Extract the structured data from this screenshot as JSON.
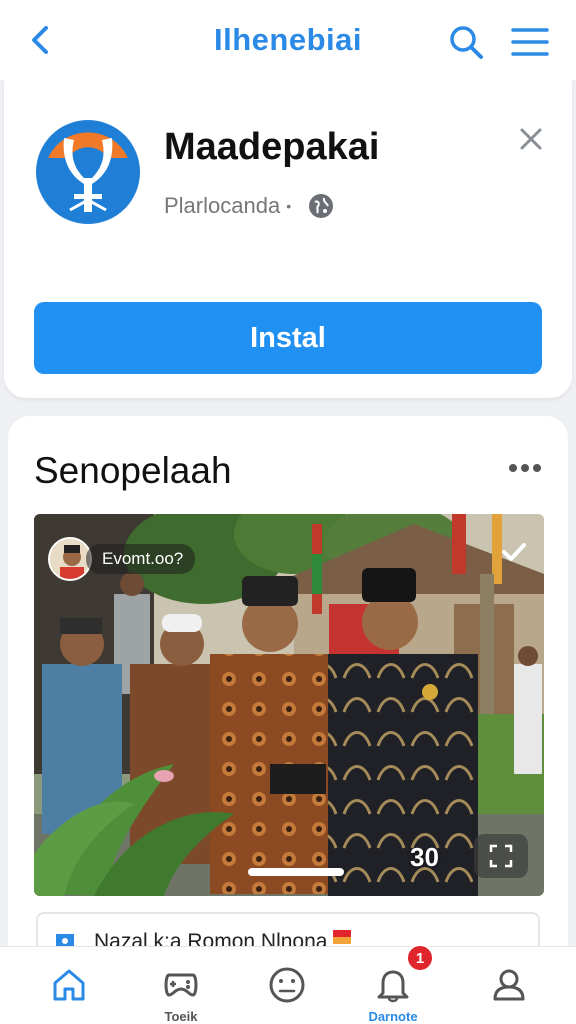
{
  "header": {
    "title": "Ilhenebiai",
    "back_icon": "chevron-left-icon",
    "search_icon": "search-icon",
    "menu_icon": "hamburger-menu-icon",
    "accent": "#2b8ae6"
  },
  "app_banner": {
    "name": "Maadepakai",
    "subtitle": "Plarlocanda",
    "separator": "•",
    "install_label": "Instal",
    "install_color": "#2090f2"
  },
  "post": {
    "title": "Senopelaah",
    "event_label": "Evomt.oo?",
    "photo_count": "30",
    "comment_preview": "Nazal k:a Romon Nlnona"
  },
  "bottom_nav": {
    "items": [
      {
        "icon": "home-icon",
        "label": ""
      },
      {
        "icon": "gamepad-icon",
        "label": "Toeik"
      },
      {
        "icon": "smiley-icon",
        "label": ""
      },
      {
        "icon": "bell-icon",
        "label": "Darnote"
      },
      {
        "icon": "profile-icon",
        "label": ""
      }
    ],
    "badge_count": "1"
  }
}
